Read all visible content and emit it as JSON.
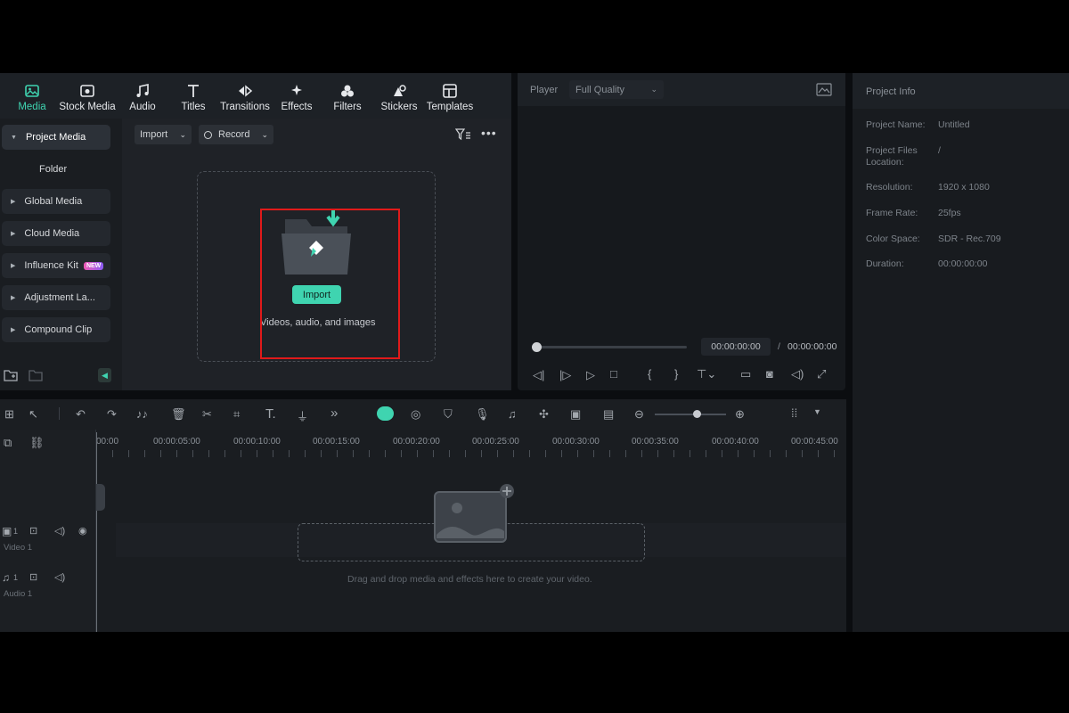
{
  "toolbar": {
    "tabs": [
      {
        "label": "Media",
        "icon": "media-icon",
        "active": true
      },
      {
        "label": "Stock Media",
        "icon": "stock-media-icon"
      },
      {
        "label": "Audio",
        "icon": "music-note-icon"
      },
      {
        "label": "Titles",
        "icon": "text-t-icon"
      },
      {
        "label": "Transitions",
        "icon": "transitions-icon"
      },
      {
        "label": "Effects",
        "icon": "sparkle-icon"
      },
      {
        "label": "Filters",
        "icon": "filters-icon"
      },
      {
        "label": "Stickers",
        "icon": "sticker-icon"
      },
      {
        "label": "Templates",
        "icon": "template-icon"
      }
    ]
  },
  "sidebar": {
    "items": [
      {
        "label": "Project Media"
      },
      {
        "label": "Folder"
      },
      {
        "label": "Global Media"
      },
      {
        "label": "Cloud Media"
      },
      {
        "label": "Influence Kit",
        "badge": "NEW"
      },
      {
        "label": "Adjustment La..."
      },
      {
        "label": "Compound Clip"
      }
    ]
  },
  "media": {
    "import_dropdown": "Import",
    "record_dropdown": "Record",
    "import_button": "Import",
    "hint": "Videos, audio, and images"
  },
  "player": {
    "label": "Player",
    "quality": "Full Quality",
    "current_time": "00:00:00:00",
    "separator": "/",
    "total_time": "00:00:00:00"
  },
  "project_info": {
    "title": "Project Info",
    "name_label": "Project Name:",
    "name_value": "Untitled",
    "files_label_1": "Project Files",
    "files_label_2": "Location:",
    "files_value": "/",
    "resolution_label": "Resolution:",
    "resolution_value": "1920 x 1080",
    "framerate_label": "Frame Rate:",
    "framerate_value": "25fps",
    "colorspace_label": "Color Space:",
    "colorspace_value": "SDR - Rec.709",
    "duration_label": "Duration:",
    "duration_value": "00:00:00:00"
  },
  "timeline": {
    "ticks": [
      "00:00",
      "00:00:05:00",
      "00:00:10:00",
      "00:00:15:00",
      "00:00:20:00",
      "00:00:25:00",
      "00:00:30:00",
      "00:00:35:00",
      "00:00:40:00",
      "00:00:45:00"
    ],
    "video_track": "Video 1",
    "audio_track": "Audio 1",
    "track_num": "1",
    "drop_hint": "Drag and drop media and effects here to create your video."
  },
  "colors": {
    "accent": "#3fd4b0",
    "highlight": "#e01a1a"
  }
}
